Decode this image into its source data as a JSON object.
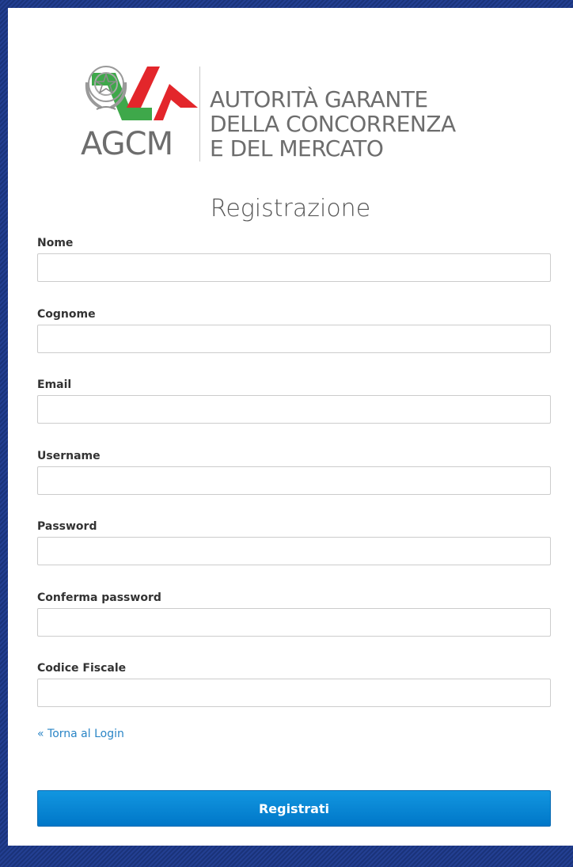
{
  "logo": {
    "abbr": "AGCM",
    "lines": [
      "AUTORITÀ GARANTE",
      "DELLA CONCORRENZA",
      "E DEL MERCATO"
    ],
    "emblem": "italian-republic-emblem-icon",
    "colors": {
      "green": "#3ea84a",
      "red": "#e3262b",
      "gray": "#6d6d6d"
    }
  },
  "page": {
    "title": "Registrazione"
  },
  "form": {
    "fields": [
      {
        "label": "Nome",
        "value": "",
        "placeholder": ""
      },
      {
        "label": "Cognome",
        "value": "",
        "placeholder": ""
      },
      {
        "label": "Email",
        "value": "",
        "placeholder": ""
      },
      {
        "label": "Username",
        "value": "",
        "placeholder": ""
      },
      {
        "label": "Password",
        "value": "",
        "placeholder": ""
      },
      {
        "label": "Conferma password",
        "value": "",
        "placeholder": ""
      },
      {
        "label": "Codice Fiscale",
        "value": "",
        "placeholder": ""
      }
    ],
    "back_link": "« Torna al Login",
    "submit_label": "Registrati"
  },
  "colors": {
    "accent": "#0a88d8",
    "link": "#2a85c6",
    "background": "#1e3a8a"
  }
}
